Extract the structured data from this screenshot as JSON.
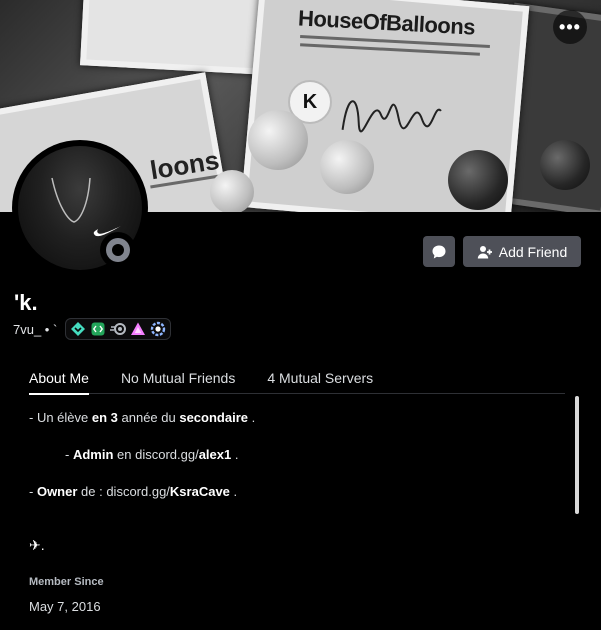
{
  "banner": {
    "headline": "HouseOfBalloons",
    "headline_partial": "loons",
    "logo_letter": "K"
  },
  "profile": {
    "display_name": "'k.",
    "username": "7vu_ • `",
    "status": "offline"
  },
  "actions": {
    "more_label": "•••",
    "add_friend_label": "Add Friend"
  },
  "badges": [
    {
      "name": "hypesquad-balance-icon",
      "color": "#45ddc0"
    },
    {
      "name": "active-developer-icon",
      "color": "#23a55a"
    },
    {
      "name": "nitro-icon",
      "color": "#b5bac1"
    },
    {
      "name": "early-supporter-icon",
      "color": "#f47fff"
    },
    {
      "name": "boost-icon",
      "color": "#8fb6ff"
    }
  ],
  "tabs": [
    {
      "label": "About Me",
      "active": true
    },
    {
      "label": "No Mutual Friends",
      "active": false
    },
    {
      "label": "4 Mutual Servers",
      "active": false
    }
  ],
  "about": {
    "line1_pre": "- Un élève ",
    "line1_bold1": "en 3",
    "line1_mid": " année du ",
    "line1_bold2": "secondaire",
    "line1_post": " .",
    "line2_pre": "- ",
    "line2_bold": "Admin",
    "line2_mid": " en discord.gg/",
    "line2_bold2": "alex1",
    "line2_post": " .",
    "line3_pre": "- ",
    "line3_bold": "Owner",
    "line3_mid": " de : discord.gg/",
    "line3_bold2": "KsraCave",
    "line3_post": " .",
    "line4": "✈."
  },
  "member_since": {
    "label": "Member Since",
    "date": "May 7, 2016"
  }
}
